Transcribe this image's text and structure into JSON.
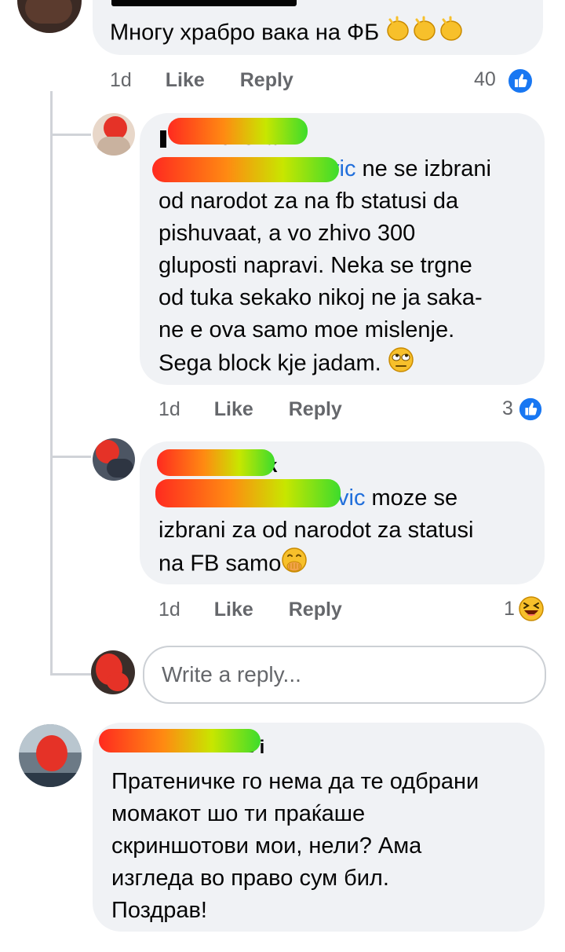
{
  "colors": {
    "bubble": "#f0f2f5",
    "meta": "#65676b",
    "mention": "#216fdb",
    "like_blue": "#1877f2",
    "redaction_gradient": [
      "#ff2a1f",
      "#ff8a12",
      "#c8e600",
      "#3ddc2c"
    ]
  },
  "comment_top": {
    "text": "Многу храбро вака на ФБ",
    "emoji": [
      "clapping-hands",
      "clapping-hands",
      "clapping-hands"
    ],
    "time": "1d",
    "like": "Like",
    "reply": "Reply",
    "reaction_count": "40",
    "reaction_icon": "like-icon"
  },
  "reply1": {
    "author_visible": "ovska",
    "mention_visible": "vic",
    "lines": [
      "ne se izbrani",
      "od narodot za na fb statusi da",
      "pishuvaat, a vo zhivo 300",
      "gluposti napravi. Neka se trgne",
      "od tuka sekako nikoj ne ja saka-",
      "ne e ova samo moe mislenje.",
      "Sega block kje jadam."
    ],
    "emoji": "eye-roll-face",
    "time": "1d",
    "like": "Like",
    "reply": "Reply",
    "reaction_count": "3",
    "reaction_icon": "like-icon"
  },
  "reply2": {
    "author_visible": "arak",
    "mention_visible": "vic",
    "lines": [
      "moze se",
      "izbrani za od narodot za statusi",
      "na FB samo"
    ],
    "emoji": "hand-over-mouth-face",
    "time": "1d",
    "like": "Like",
    "reply": "Reply",
    "reaction_count": "1",
    "reaction_icon": "laughing-face"
  },
  "reply_input": {
    "placeholder": "Write a reply..."
  },
  "comment_bottom": {
    "author_visible": "i",
    "lines": [
      "Пратеничке го нема да те одбрани",
      "момакот шо ти праќаше",
      "скриншотови мои, нели? Ама",
      "изгледа во право сум бил.",
      "Поздрав!"
    ]
  }
}
